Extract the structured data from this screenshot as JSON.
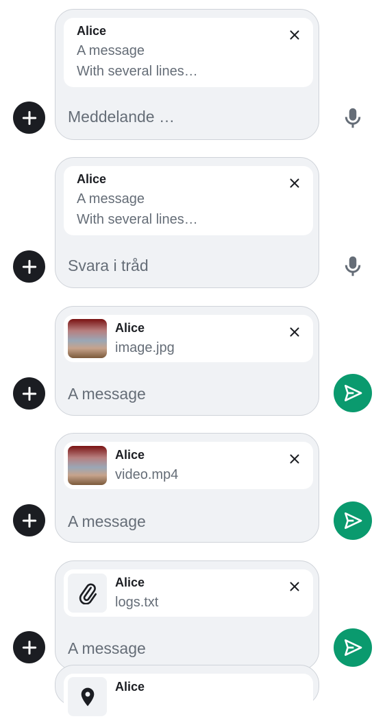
{
  "composers": [
    {
      "sender": "Alice",
      "lines": [
        "A message",
        "With several lines…"
      ],
      "placeholder": "Meddelande …",
      "action": "mic-icon"
    },
    {
      "sender": "Alice",
      "lines": [
        "A message",
        "With several lines…"
      ],
      "placeholder": "Svara i tråd",
      "action": "mic-icon"
    },
    {
      "sender": "Alice",
      "file": "image.jpg",
      "placeholder": "A message",
      "action": "send-icon"
    },
    {
      "sender": "Alice",
      "file": "video.mp4",
      "placeholder": "A message",
      "action": "send-icon"
    },
    {
      "sender": "Alice",
      "file": "logs.txt",
      "placeholder": "A message",
      "action": "send-icon"
    },
    {
      "sender": "Alice"
    }
  ],
  "icons": {
    "add": "plus-icon",
    "close": "close-icon",
    "mic": "mic-icon",
    "send": "send-icon",
    "attachment": "paperclip-icon",
    "location": "location-pin-icon"
  },
  "colors": {
    "send_button": "#0a9a6e",
    "add_button": "#1b1d22",
    "composer_bg": "#f0f2f5",
    "placeholder_text": "#656d77"
  }
}
